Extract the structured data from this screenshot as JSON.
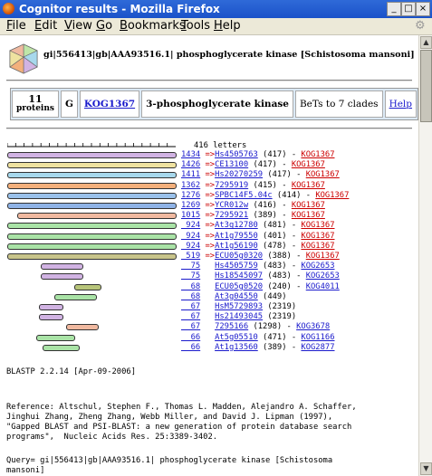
{
  "window": {
    "title": "Cognitor results - Mozilla Firefox",
    "buttons": [
      "_",
      "□",
      "×"
    ]
  },
  "menubar": {
    "items": [
      {
        "label": "File",
        "key": "F"
      },
      {
        "label": "Edit",
        "key": "E"
      },
      {
        "label": "View",
        "key": "V"
      },
      {
        "label": "Go",
        "key": "G"
      },
      {
        "label": "Bookmarks",
        "key": "B"
      },
      {
        "label": "Tools",
        "key": "T"
      },
      {
        "label": "Help",
        "key": "H"
      }
    ]
  },
  "page": {
    "heading": "gi|556413|gb|AAA93516.1| phosphoglycerate kinase [Schistosoma mansoni] (416 letters)",
    "summary": {
      "count": "11",
      "count_label": "proteins",
      "category": "G",
      "kog_id": "KOG1367",
      "kog_name": "3-phosphoglycerate kinase",
      "bets": "BeTs to 7 clades",
      "help": "Help"
    },
    "ruler_label": "416 letters",
    "hits": [
      {
        "score": "1434",
        "arrow": true,
        "name": "Hs4505763",
        "len": "(417)",
        "kog": "KOG1367",
        "kog_color": "red",
        "bar": {
          "s": 0.0,
          "e": 0.995,
          "color": "#d1b3e3"
        }
      },
      {
        "score": "1426",
        "arrow": true,
        "name": "CE13100",
        "len": "(417)",
        "kog": "KOG1367",
        "kog_color": "red",
        "bar": {
          "s": 0.0,
          "e": 0.995,
          "color": "#efe2a0"
        }
      },
      {
        "score": "1411",
        "arrow": true,
        "name": "Hs20270259",
        "len": "(417)",
        "kog": "KOG1367",
        "kog_color": "red",
        "bar": {
          "s": 0.0,
          "e": 0.995,
          "color": "#a7d8ec"
        }
      },
      {
        "score": "1362",
        "arrow": true,
        "name": "7295919",
        "len": "(415)",
        "kog": "KOG1367",
        "kog_color": "red",
        "bar": {
          "s": 0.0,
          "e": 0.995,
          "color": "#f3b07c"
        }
      },
      {
        "score": "1276",
        "arrow": true,
        "name": "SPBC14F5.04c",
        "len": "(414)",
        "kog": "KOG1367",
        "kog_color": "red",
        "bar": {
          "s": 0.0,
          "e": 0.995,
          "color": "#9ac1ea"
        }
      },
      {
        "score": "1269",
        "arrow": true,
        "name": "YCR012w",
        "len": "(416)",
        "kog": "KOG1367",
        "kog_color": "red",
        "bar": {
          "s": 0.0,
          "e": 0.995,
          "color": "#8fb3e6"
        }
      },
      {
        "score": "1015",
        "arrow": true,
        "name": "7295921",
        "len": "(389)",
        "kog": "KOG1367",
        "kog_color": "red",
        "bar": {
          "s": 0.06,
          "e": 0.995,
          "color": "#f0b9a0"
        }
      },
      {
        "score": "924",
        "arrow": true,
        "name": "At3g12780",
        "len": "(481)",
        "kog": "KOG1367",
        "kog_color": "red",
        "bar": {
          "s": 0.0,
          "e": 0.995,
          "color": "#a9e3a6"
        }
      },
      {
        "score": "924",
        "arrow": true,
        "name": "At1g79550",
        "len": "(401)",
        "kog": "KOG1367",
        "kog_color": "red",
        "bar": {
          "s": 0.0,
          "e": 0.995,
          "color": "#a9e3a6"
        }
      },
      {
        "score": "924",
        "arrow": true,
        "name": "At1g56190",
        "len": "(478)",
        "kog": "KOG1367",
        "kog_color": "red",
        "bar": {
          "s": 0.0,
          "e": 0.995,
          "color": "#a9e3a6"
        }
      },
      {
        "score": "519",
        "arrow": true,
        "name": "ECU05g0320",
        "len": "(388)",
        "kog": "KOG1367",
        "kog_color": "red",
        "bar": {
          "s": 0.0,
          "e": 0.995,
          "color": "#c8c48a"
        }
      },
      {
        "score": "75",
        "arrow": false,
        "name": "Hs4505759",
        "len": "(483)",
        "kog": "KOG2653",
        "kog_color": "blue",
        "bar": {
          "s": 0.2,
          "e": 0.44,
          "color": "#d1b3e3"
        }
      },
      {
        "score": "75",
        "arrow": false,
        "name": "Hs18545097",
        "len": "(483)",
        "kog": "KOG2653",
        "kog_color": "blue",
        "bar": {
          "s": 0.2,
          "e": 0.44,
          "color": "#d1b3e3"
        }
      },
      {
        "score": "68",
        "arrow": false,
        "name": "ECU05g0520",
        "len": "(240)",
        "kog": "KOG4011",
        "kog_color": "blue",
        "bar": {
          "s": 0.4,
          "e": 0.55,
          "color": "#b7c47a"
        }
      },
      {
        "score": "68",
        "arrow": false,
        "name": "At3g04550",
        "len": "(449)",
        "kog": "",
        "kog_color": "",
        "bar": {
          "s": 0.28,
          "e": 0.52,
          "color": "#a9e3a6"
        }
      },
      {
        "score": "67",
        "arrow": false,
        "name": "HsM5729893",
        "len": "(2319)",
        "kog": "",
        "kog_color": "",
        "bar": {
          "s": 0.19,
          "e": 0.32,
          "color": "#d1b3e3"
        }
      },
      {
        "score": "67",
        "arrow": false,
        "name": "Hs21493045",
        "len": "(2319)",
        "kog": "",
        "kog_color": "",
        "bar": {
          "s": 0.19,
          "e": 0.32,
          "color": "#d1b3e3"
        }
      },
      {
        "score": "67",
        "arrow": false,
        "name": "7295166",
        "len": "(1298)",
        "kog": "KOG3678",
        "kog_color": "blue",
        "bar": {
          "s": 0.35,
          "e": 0.53,
          "color": "#f0b9a0"
        }
      },
      {
        "score": "66",
        "arrow": false,
        "name": "At5g05510",
        "len": "(471)",
        "kog": "KOG1166",
        "kog_color": "blue",
        "bar": {
          "s": 0.17,
          "e": 0.39,
          "color": "#a9e3a6"
        }
      },
      {
        "score": "66",
        "arrow": false,
        "name": "At1g13560",
        "len": "(389)",
        "kog": "KOG2877",
        "kog_color": "blue",
        "bar": {
          "s": 0.21,
          "e": 0.42,
          "color": "#a9e3a6"
        }
      }
    ],
    "blast_version": "BLASTP 2.2.14 [Apr-09-2006]",
    "reference": "Reference: Altschul, Stephen F., Thomas L. Madden, Alejandro A. Schaffer,\nJinghui Zhang, Zheng Zhang, Webb Miller, and David J. Lipman (1997),\n\"Gapped BLAST and PSI-BLAST: a new generation of protein database search\nprograms\",  Nucleic Acids Res. 25:3389-3402.",
    "query": "Query= gi|556413|gb|AAA93516.1| phosphoglycerate kinase [Schistosoma\nmansoni]"
  }
}
